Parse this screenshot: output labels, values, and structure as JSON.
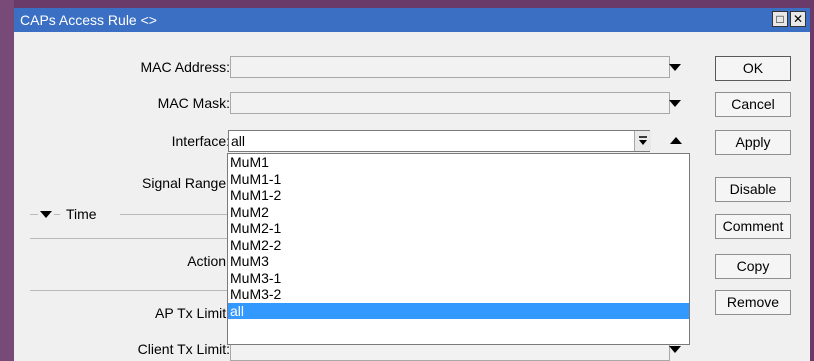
{
  "window": {
    "title": "CAPs Access Rule <>",
    "controls": {
      "restore_symbol": "□",
      "close_symbol": "✕"
    }
  },
  "form": {
    "mac_address": {
      "label": "MAC Address:",
      "value": ""
    },
    "mac_mask": {
      "label": "MAC Mask:",
      "value": ""
    },
    "interface": {
      "label": "Interface:",
      "value": "all",
      "options": [
        "MuM1",
        "MuM1-1",
        "MuM1-2",
        "MuM2",
        "MuM2-1",
        "MuM2-2",
        "MuM3",
        "MuM3-1",
        "MuM3-2",
        "all"
      ],
      "selected": "all"
    },
    "signal_range": {
      "label": "Signal Range:"
    },
    "time_section": {
      "label": "Time"
    },
    "action": {
      "label": "Action:"
    },
    "ap_tx_limit": {
      "label": "AP Tx Limit:"
    },
    "client_tx_limit": {
      "label": "Client Tx Limit:"
    }
  },
  "buttons": {
    "ok": "OK",
    "cancel": "Cancel",
    "apply": "Apply",
    "disable": "Disable",
    "comment": "Comment",
    "copy": "Copy",
    "remove": "Remove"
  },
  "colors": {
    "titlebar": "#3a6fc4",
    "selection": "#3399ff",
    "frame": "#774a78"
  }
}
